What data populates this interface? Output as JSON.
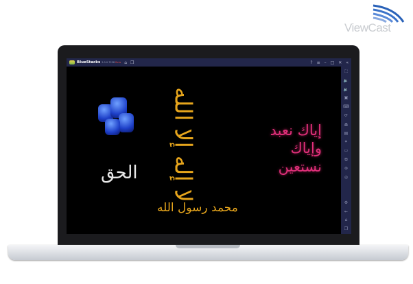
{
  "brand": {
    "logo_text": "ViewCast",
    "accent": "#2a62b8"
  },
  "app": {
    "name": "BlueStacks",
    "version": "5.0.0.7228",
    "channel": "Beta"
  },
  "titlebar": {
    "icons": [
      "home-icon",
      "multi-instance-icon",
      "help-icon",
      "menu-icon",
      "minimize-icon",
      "maximize-icon",
      "close-icon",
      "collapse-sidebar-icon"
    ],
    "glyphs": {
      "home": "⌂",
      "multi": "❐",
      "help": "?",
      "menu": "≡",
      "min": "–",
      "max": "□",
      "close": "✕",
      "collapse": "«"
    }
  },
  "sidebar": {
    "icons": [
      "fullscreen-icon",
      "volume-up-icon",
      "volume-down-icon",
      "screen-record-icon",
      "keyboard-icon",
      "rotate-icon",
      "install-apk-icon",
      "media-manager-icon",
      "screenshot-icon",
      "folder-icon",
      "multi-instance-icon",
      "macro-icon",
      "eco-mode-icon",
      "settings-icon",
      "back-icon",
      "home-icon",
      "recent-apps-icon"
    ],
    "glyphs": [
      "⛶",
      "🔈",
      "🔉",
      "▣",
      "⌨",
      "⟳",
      "⏏",
      "▤",
      "⌗",
      "▭",
      "⧉",
      "⊛",
      "◎",
      "⚙",
      "←",
      "⌂",
      "❐"
    ]
  },
  "artwork": {
    "left_calligraphy": "الحق",
    "center_top": "لا إله إلا الله",
    "center_bottom": "محمد رسول الله",
    "right_line1": "إياك نعبد",
    "right_line2": "وإياك نستعين"
  }
}
